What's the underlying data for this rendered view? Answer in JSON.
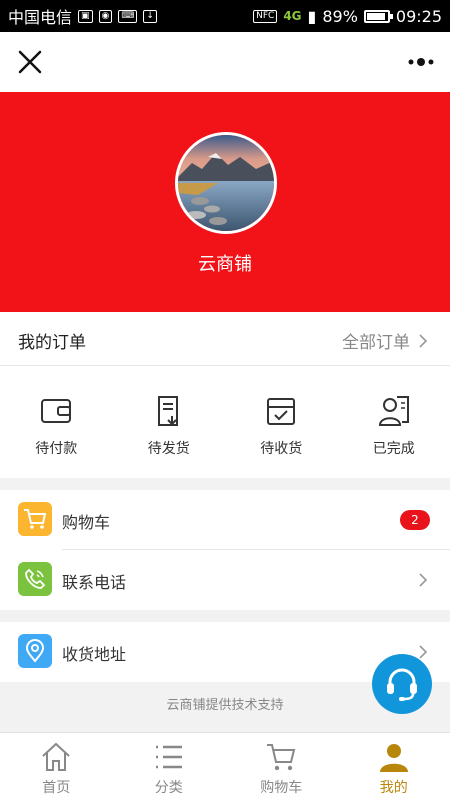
{
  "status_bar": {
    "carrier": "中国电信",
    "nfc": "NFC",
    "network": "4G",
    "battery": "89%",
    "time": "09:25"
  },
  "header": {
    "shop_name": "云商铺"
  },
  "orders": {
    "title": "我的订单",
    "all_label": "全部订单",
    "items": [
      {
        "label": "待付款",
        "icon": "wallet-icon"
      },
      {
        "label": "待发货",
        "icon": "shipping-doc-icon"
      },
      {
        "label": "待收货",
        "icon": "inbox-check-icon"
      },
      {
        "label": "已完成",
        "icon": "user-doc-icon"
      }
    ]
  },
  "menu": {
    "cart": {
      "label": "购物车",
      "badge": "2"
    },
    "phone": {
      "label": "联系电话"
    },
    "address": {
      "label": "收货地址"
    }
  },
  "footer_note": "云商铺提供技术支持",
  "tabbar": {
    "items": [
      {
        "label": "首页",
        "icon": "home-icon"
      },
      {
        "label": "分类",
        "icon": "list-icon"
      },
      {
        "label": "购物车",
        "icon": "cart-icon"
      },
      {
        "label": "我的",
        "icon": "user-icon"
      }
    ],
    "active": "我的"
  },
  "colors": {
    "hero": "#f21319",
    "cart_icon_bg": "#fbb52e",
    "phone_icon_bg": "#7bc33f",
    "address_icon_bg": "#3fa9f5",
    "cs_button": "#1296db",
    "active_tab": "#b8860b"
  }
}
